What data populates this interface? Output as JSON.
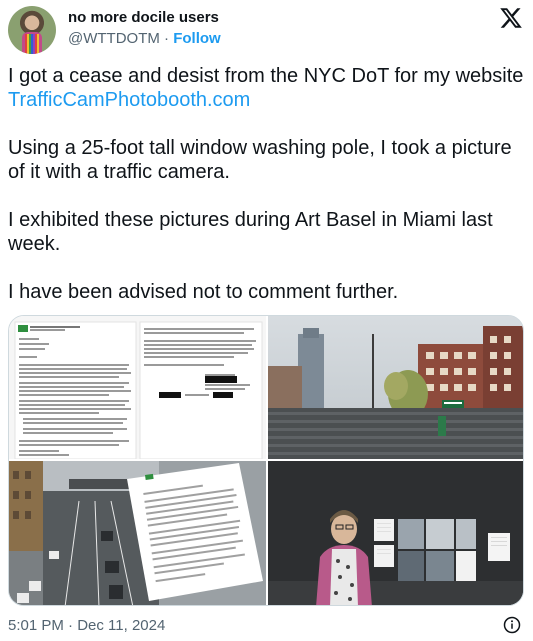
{
  "author": {
    "name": "no more docile users",
    "handle": "@WTTDOTM",
    "separator": " · ",
    "follow_label": "Follow"
  },
  "logo_icon": "x-logo-icon",
  "tweet": {
    "line1": "I got a cease and desist from the NYC DoT for my website",
    "link": "TrafficCamPhotobooth.com",
    "para2": "Using a 25-foot tall window washing pole, I took a picture of it with a traffic camera.",
    "para3": "I exhibited these pictures during Art Basel in Miami last week.",
    "para4": "I have been advised not to comment further."
  },
  "media": {
    "letter_org": "Department of Transportation"
  },
  "footer": {
    "timestamp": "5:01 PM · Dec 11, 2024",
    "info_icon": "info-icon"
  },
  "colors": {
    "accent": "#1d9bf0",
    "text": "#0f1419",
    "muted": "#536471"
  }
}
